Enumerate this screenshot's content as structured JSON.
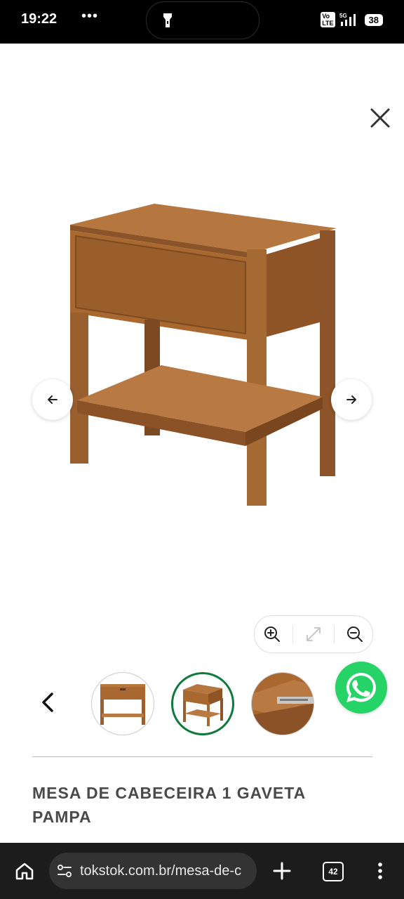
{
  "status_bar": {
    "time": "19:22",
    "more": "•••",
    "network": "5G",
    "battery": "38"
  },
  "gallery": {
    "close_icon": "close-icon",
    "prev_icon": "arrow-left-icon",
    "next_icon": "arrow-right-icon",
    "zoom_in_icon": "zoom-in-icon",
    "fullscreen_icon": "expand-icon",
    "zoom_out_icon": "zoom-out-icon",
    "thumbnails_prev_icon": "chevron-left-icon",
    "thumbnails": [
      {
        "name": "thumbnail-front",
        "active": false
      },
      {
        "name": "thumbnail-angle",
        "active": true
      },
      {
        "name": "thumbnail-drawer-detail",
        "active": false
      }
    ]
  },
  "product": {
    "title": "MESA DE CABECEIRA 1 GAVETA PAMPA"
  },
  "whatsapp": {
    "icon": "whatsapp-icon",
    "color": "#25d366"
  },
  "browser": {
    "url": "tokstok.com.br/mesa-de-c",
    "tab_count": "42"
  },
  "colors": {
    "accent_green": "#0f7a3c",
    "title_text": "#4a4a4a",
    "wood": "#9a5f2e"
  }
}
